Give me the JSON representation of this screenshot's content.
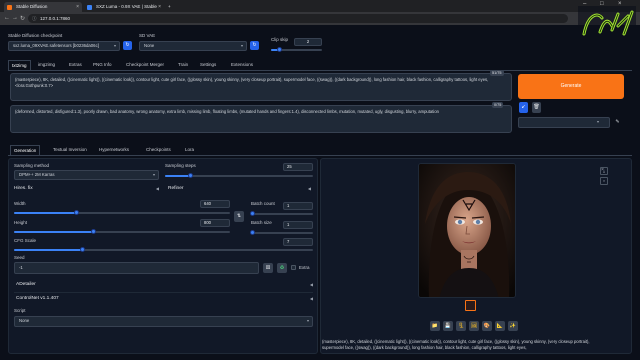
{
  "browser": {
    "tabs": [
      {
        "title": "Stable Diffusion"
      },
      {
        "title": "SXZ Luma - 0.9X VAE | Stable"
      }
    ],
    "url": "127.0.0.1:7860"
  },
  "header": {
    "checkpoint_label": "Stable Diffusion checkpoint",
    "checkpoint_value": "sxz.luma_09XVAE.safetensors [b0236da06c]",
    "vae_label": "SD VAE",
    "vae_value": "None",
    "clip_skip_label": "Clip skip",
    "clip_skip_value": "2",
    "clip_skip_fraction": 0.17
  },
  "main_tabs": [
    "txt2img",
    "img2img",
    "Extras",
    "PNG Info",
    "Checkpoint Merger",
    "Train",
    "Settings",
    "Extensions"
  ],
  "prompt": {
    "positive": "(masterpiece), 8K, detailed, ((cinematic light)), ((cinematic look)), contour light, cute girl face, ((glossy skin), young skinny, (very closeup portrait), supermodel face, ((swag)), ((dark background)), long fashion hair, black fashion, calligraphy tattoos, light eyes, <lora:Gothpunk:0.7>",
    "positive_count": "51/75",
    "negative": "(deformed, distorted, disfigured:1.3), poorly drawn, bad anatomy, wrong anatomy, extra limb, missing limb, floating limbs, (mutated hands and fingers:1.4), disconnected limbs, mutation, mutated, ugly, disgusting, blurry, amputation",
    "negative_count": "0/75"
  },
  "generate_label": "Generate",
  "sub_tabs": [
    "Generation",
    "Textual Inversion",
    "Hypernetworks",
    "Checkpoints",
    "Lora"
  ],
  "params": {
    "sampling_method_label": "Sampling method",
    "sampling_method_value": "DPM++ 2M Karras",
    "sampling_steps_label": "Sampling steps",
    "sampling_steps_value": "25",
    "sampling_steps_fraction": 0.17,
    "hires_label": "Hires. fix",
    "refiner_label": "Refiner",
    "width_label": "Width",
    "width_value": "640",
    "width_fraction": 0.29,
    "height_label": "Height",
    "height_value": "800",
    "height_fraction": 0.37,
    "batch_count_label": "Batch count",
    "batch_count_value": "1",
    "batch_size_label": "Batch size",
    "batch_size_value": "1",
    "cfg_label": "CFG Scale",
    "cfg_value": "7",
    "cfg_fraction": 0.23,
    "seed_label": "Seed",
    "seed_value": "-1",
    "extra_label": "Extra",
    "adetailer_label": "ADetailer",
    "controlnet_label": "ControlNet v1.1.407",
    "script_label": "Script",
    "script_value": "None"
  },
  "output": {
    "info_text": "(masterpiece), 8K, detailed, ((cinematic light)), ((cinematic look)), contour light, cute girl face, ((glossy skin), young skinny, (very closeup portrait), supermodel face, ((swag)), ((dark background)), long fashion hair, black fashion, calligraphy tattoos, light eyes,"
  },
  "watermark": "CarTeL",
  "colors": {
    "accent": "#f97316",
    "primary": "#2563eb",
    "background": "#0b0f19"
  }
}
